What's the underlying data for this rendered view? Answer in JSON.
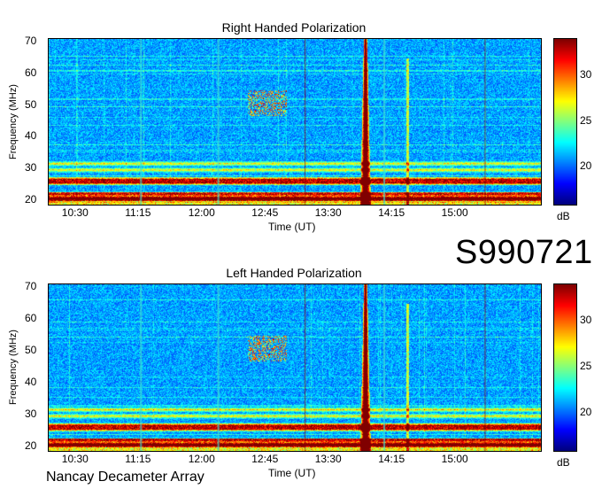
{
  "figure": {
    "dataset_id": "S990721",
    "footer": "Nancay Decameter Array"
  },
  "chart_data": [
    {
      "type": "heatmap",
      "title": "Right Handed Polarization",
      "xlabel": "Time (UT)",
      "ylabel": "Frequency (MHz)",
      "x_ticks": [
        "10:30",
        "11:15",
        "12:00",
        "12:45",
        "13:30",
        "14:15",
        "15:00"
      ],
      "y_ticks": [
        20,
        30,
        40,
        50,
        60,
        70
      ],
      "ylim": [
        19,
        71
      ],
      "xlim": [
        "10:10",
        "16:00"
      ],
      "colorbar": {
        "label": "dB",
        "ticks": [
          20,
          25,
          30
        ],
        "range": [
          16,
          34
        ],
        "colormap": "jet"
      },
      "features": {
        "interference_bands_mhz": [
          21,
          22.5,
          26,
          27,
          30,
          32
        ],
        "burst": {
          "time": "13:55",
          "freq_range_mhz": [
            19,
            71
          ]
        },
        "burst_secondary": {
          "time": "14:25",
          "freq_range_mhz": [
            19,
            65
          ]
        },
        "emission_patch": {
          "time": "12:45",
          "freq_range_mhz": [
            47,
            55
          ]
        }
      }
    },
    {
      "type": "heatmap",
      "title": "Left Handed Polarization",
      "xlabel": "Time (UT)",
      "ylabel": "Frequency (MHz)",
      "x_ticks": [
        "10:30",
        "11:15",
        "12:00",
        "12:45",
        "13:30",
        "14:15",
        "15:00"
      ],
      "y_ticks": [
        20,
        30,
        40,
        50,
        60,
        70
      ],
      "ylim": [
        19,
        71
      ],
      "xlim": [
        "10:10",
        "16:00"
      ],
      "colorbar": {
        "label": "dB",
        "ticks": [
          20,
          25,
          30
        ],
        "range": [
          16,
          34
        ],
        "colormap": "jet"
      },
      "features": {
        "interference_bands_mhz": [
          21,
          22.5,
          26,
          27,
          30,
          32
        ],
        "burst": {
          "time": "13:55",
          "freq_range_mhz": [
            19,
            71
          ]
        },
        "burst_secondary": {
          "time": "14:25",
          "freq_range_mhz": [
            19,
            65
          ]
        },
        "emission_patch": {
          "time": "12:45",
          "freq_range_mhz": [
            47,
            55
          ]
        }
      }
    }
  ]
}
